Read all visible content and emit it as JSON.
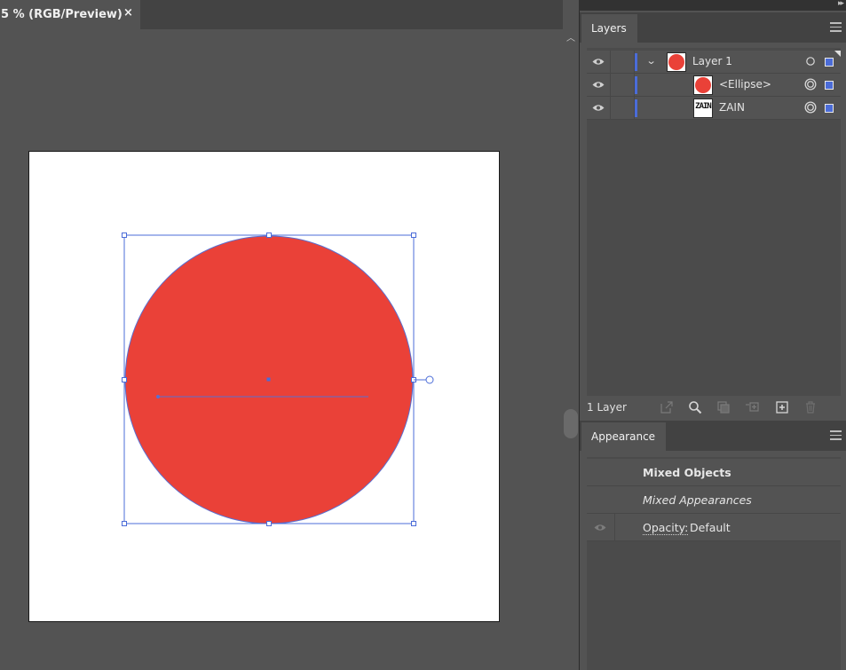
{
  "document": {
    "tab_title": "5 % (RGB/Preview)",
    "close_icon": "×",
    "ellipse_fill": "#ea4138",
    "selection_color": "#4b6cd8"
  },
  "layers_panel": {
    "tab_label": "Layers",
    "layers": [
      {
        "name": "Layer 1",
        "thumbnail": "red-circle",
        "expanded": true
      },
      {
        "name": "<Ellipse>",
        "thumbnail": "red-circle"
      },
      {
        "name": "ZAIN",
        "thumbnail": "text",
        "thumbnail_text": "ZAIN"
      }
    ],
    "footer_count": "1 Layer",
    "footer_icons": [
      "export-icon",
      "search-icon",
      "clipping-mask-icon",
      "sublayer-icon",
      "new-layer-icon",
      "trash-icon"
    ]
  },
  "appearance_panel": {
    "tab_label": "Appearance",
    "rows": [
      {
        "text": "Mixed Objects",
        "style": "bold"
      },
      {
        "text": "Mixed Appearances",
        "style": "italic"
      }
    ],
    "opacity_label": "Opacity:",
    "opacity_value": "Default"
  }
}
